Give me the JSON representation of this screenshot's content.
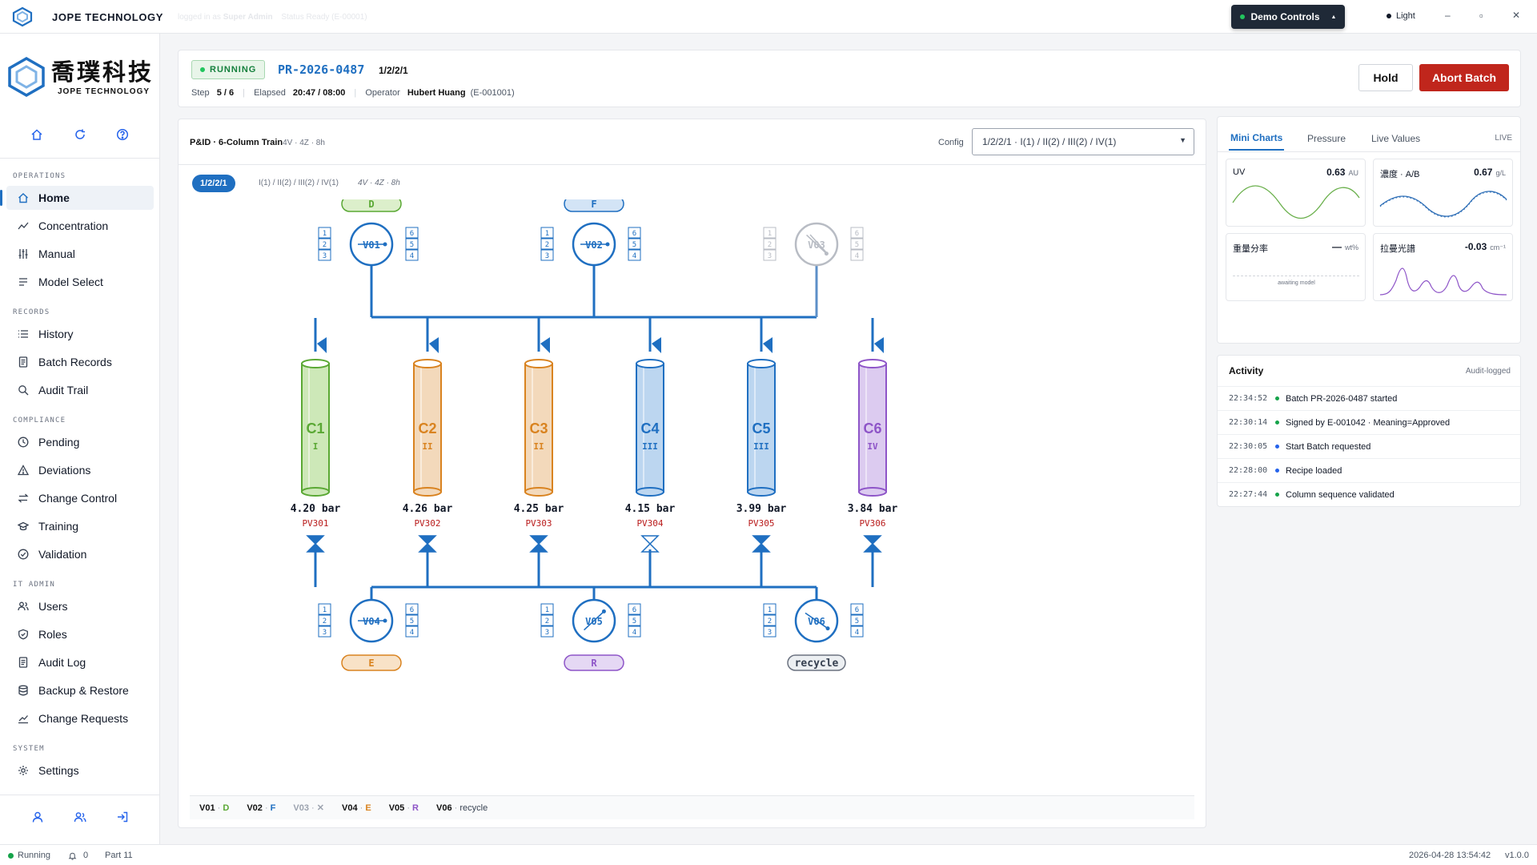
{
  "app": {
    "title": "JOPE TECHNOLOGY",
    "logged_in_text": "logged in as",
    "user_role": "Super Admin",
    "status_hint": "Status Ready (E-00001)"
  },
  "titlebar": {
    "demo_controls": "Demo Controls",
    "theme": "Light",
    "minimize": "–",
    "maximize": "▫",
    "close": "✕"
  },
  "brand": {
    "chinese": "喬璞科技",
    "english": "JOPE TECHNOLOGY"
  },
  "sidebar": {
    "sections": [
      {
        "title": "OPERATIONS",
        "items": [
          "Home",
          "Concentration",
          "Manual",
          "Model Select"
        ]
      },
      {
        "title": "RECORDS",
        "items": [
          "History",
          "Batch Records",
          "Audit Trail"
        ]
      },
      {
        "title": "COMPLIANCE",
        "items": [
          "Pending",
          "Deviations",
          "Change Control",
          "Training",
          "Validation"
        ]
      },
      {
        "title": "IT ADMIN",
        "items": [
          "Users",
          "Roles",
          "Audit Log",
          "Backup & Restore",
          "Change Requests"
        ]
      },
      {
        "title": "SYSTEM",
        "items": [
          "Settings"
        ]
      }
    ]
  },
  "batch": {
    "status": "RUNNING",
    "id": "PR-2026-0487",
    "config": "1/2/2/1",
    "step_label": "Step",
    "step": "5 / 6",
    "elapsed_label": "Elapsed",
    "elapsed": "20:47 / 08:00",
    "operator_label": "Operator",
    "operator": "Hubert Huang",
    "operator_id": "(E-001001)",
    "hold": "Hold",
    "abort": "Abort Batch"
  },
  "pid": {
    "title": "P&ID · 6-Column Train",
    "subtitle": "4V · 4Z · 8h",
    "config_label": "Config",
    "config_value": "1/2/2/1 · I(1) / II(2) / III(2) / IV(1)",
    "pill": "1/2/2/1",
    "pill_detail": "I(1) / II(2) / III(2) / IV(1)",
    "pill_note": "4V · 4Z · 8h",
    "top_valves": [
      {
        "id": "V01",
        "tag": "D",
        "ports_left": [
          "1",
          "2",
          "3"
        ],
        "ports_right": [
          "6",
          "5",
          "4"
        ]
      },
      {
        "id": "V02",
        "tag": "F",
        "ports_left": [
          "1",
          "2",
          "3"
        ],
        "ports_right": [
          "6",
          "5",
          "4"
        ]
      },
      {
        "id": "V03",
        "tag": "",
        "ports_left": [
          "1",
          "2",
          "3"
        ],
        "ports_right": [
          "6",
          "5",
          "4"
        ]
      }
    ],
    "bottom_valves": [
      {
        "id": "V04",
        "tag": "E",
        "ports_left": [
          "1",
          "2",
          "3"
        ],
        "ports_right": [
          "6",
          "5",
          "4"
        ]
      },
      {
        "id": "V05",
        "tag": "R",
        "ports_left": [
          "1",
          "2",
          "3"
        ],
        "ports_right": [
          "6",
          "5",
          "4"
        ]
      },
      {
        "id": "V06",
        "tag": "recycle",
        "ports_left": [
          "1",
          "2",
          "3"
        ],
        "ports_right": [
          "6",
          "5",
          "4"
        ]
      }
    ],
    "columns": [
      {
        "id": "C1",
        "zone": "I",
        "pressure": "4.20 bar",
        "pv": "PV301",
        "color": "#5aa834",
        "fill": "#cde8b8"
      },
      {
        "id": "C2",
        "zone": "II",
        "pressure": "4.26 bar",
        "pv": "PV302",
        "color": "#d98320",
        "fill": "#f3d9bb"
      },
      {
        "id": "C3",
        "zone": "II",
        "pressure": "4.25 bar",
        "pv": "PV303",
        "color": "#d98320",
        "fill": "#f3d9bb"
      },
      {
        "id": "C4",
        "zone": "III",
        "pressure": "4.15 bar",
        "pv": "PV304",
        "color": "#1f6fc1",
        "fill": "#bcd6f0"
      },
      {
        "id": "C5",
        "zone": "III",
        "pressure": "3.99 bar",
        "pv": "PV305",
        "color": "#1f6fc1",
        "fill": "#bcd6f0"
      },
      {
        "id": "C6",
        "zone": "IV",
        "pressure": "3.84 bar",
        "pv": "PV306",
        "color": "#8e55c8",
        "fill": "#dccbf0"
      }
    ],
    "legend": [
      {
        "id": "V01",
        "tag": "D",
        "color": "#5aa834"
      },
      {
        "id": "V02",
        "tag": "F",
        "color": "#1f6fc1"
      },
      {
        "id": "V03",
        "tag": "✕",
        "color": "#9ca3af"
      },
      {
        "id": "V04",
        "tag": "E",
        "color": "#d98320"
      },
      {
        "id": "V05",
        "tag": "R",
        "color": "#8e55c8"
      },
      {
        "id": "V06",
        "tag": "recycle",
        "color": "#374151"
      }
    ]
  },
  "right_panel": {
    "tabs": [
      "Mini Charts",
      "Pressure",
      "Live Values"
    ],
    "live": "LIVE",
    "charts": [
      {
        "label": "UV",
        "value": "0.63",
        "unit": "AU"
      },
      {
        "label": "濃度 · A/B",
        "value": "0.67",
        "unit": "g/L"
      },
      {
        "label": "重量分率",
        "value": "—",
        "unit": "wt%",
        "note": "awaiting model"
      },
      {
        "label": "拉曼光譜",
        "value": "-0.03",
        "unit": "cm⁻¹"
      }
    ],
    "activity_title": "Activity",
    "activity_note": "Audit-logged",
    "activity": [
      {
        "time": "22:34:52",
        "text": "Batch PR-2026-0487 started",
        "color": "#16a34a"
      },
      {
        "time": "22:30:14",
        "text": "Signed by E-001042 · Meaning=Approved",
        "color": "#16a34a"
      },
      {
        "time": "22:30:05",
        "text": "Start Batch requested",
        "color": "#2563eb"
      },
      {
        "time": "22:28:00",
        "text": "Recipe loaded",
        "color": "#2563eb"
      },
      {
        "time": "22:27:44",
        "text": "Column sequence validated",
        "color": "#16a34a"
      }
    ]
  },
  "statusbar": {
    "state": "Running",
    "alerts": "0",
    "part": "Part 11",
    "datetime": "2026-04-28 13:54:42",
    "version": "v1.0.0"
  }
}
